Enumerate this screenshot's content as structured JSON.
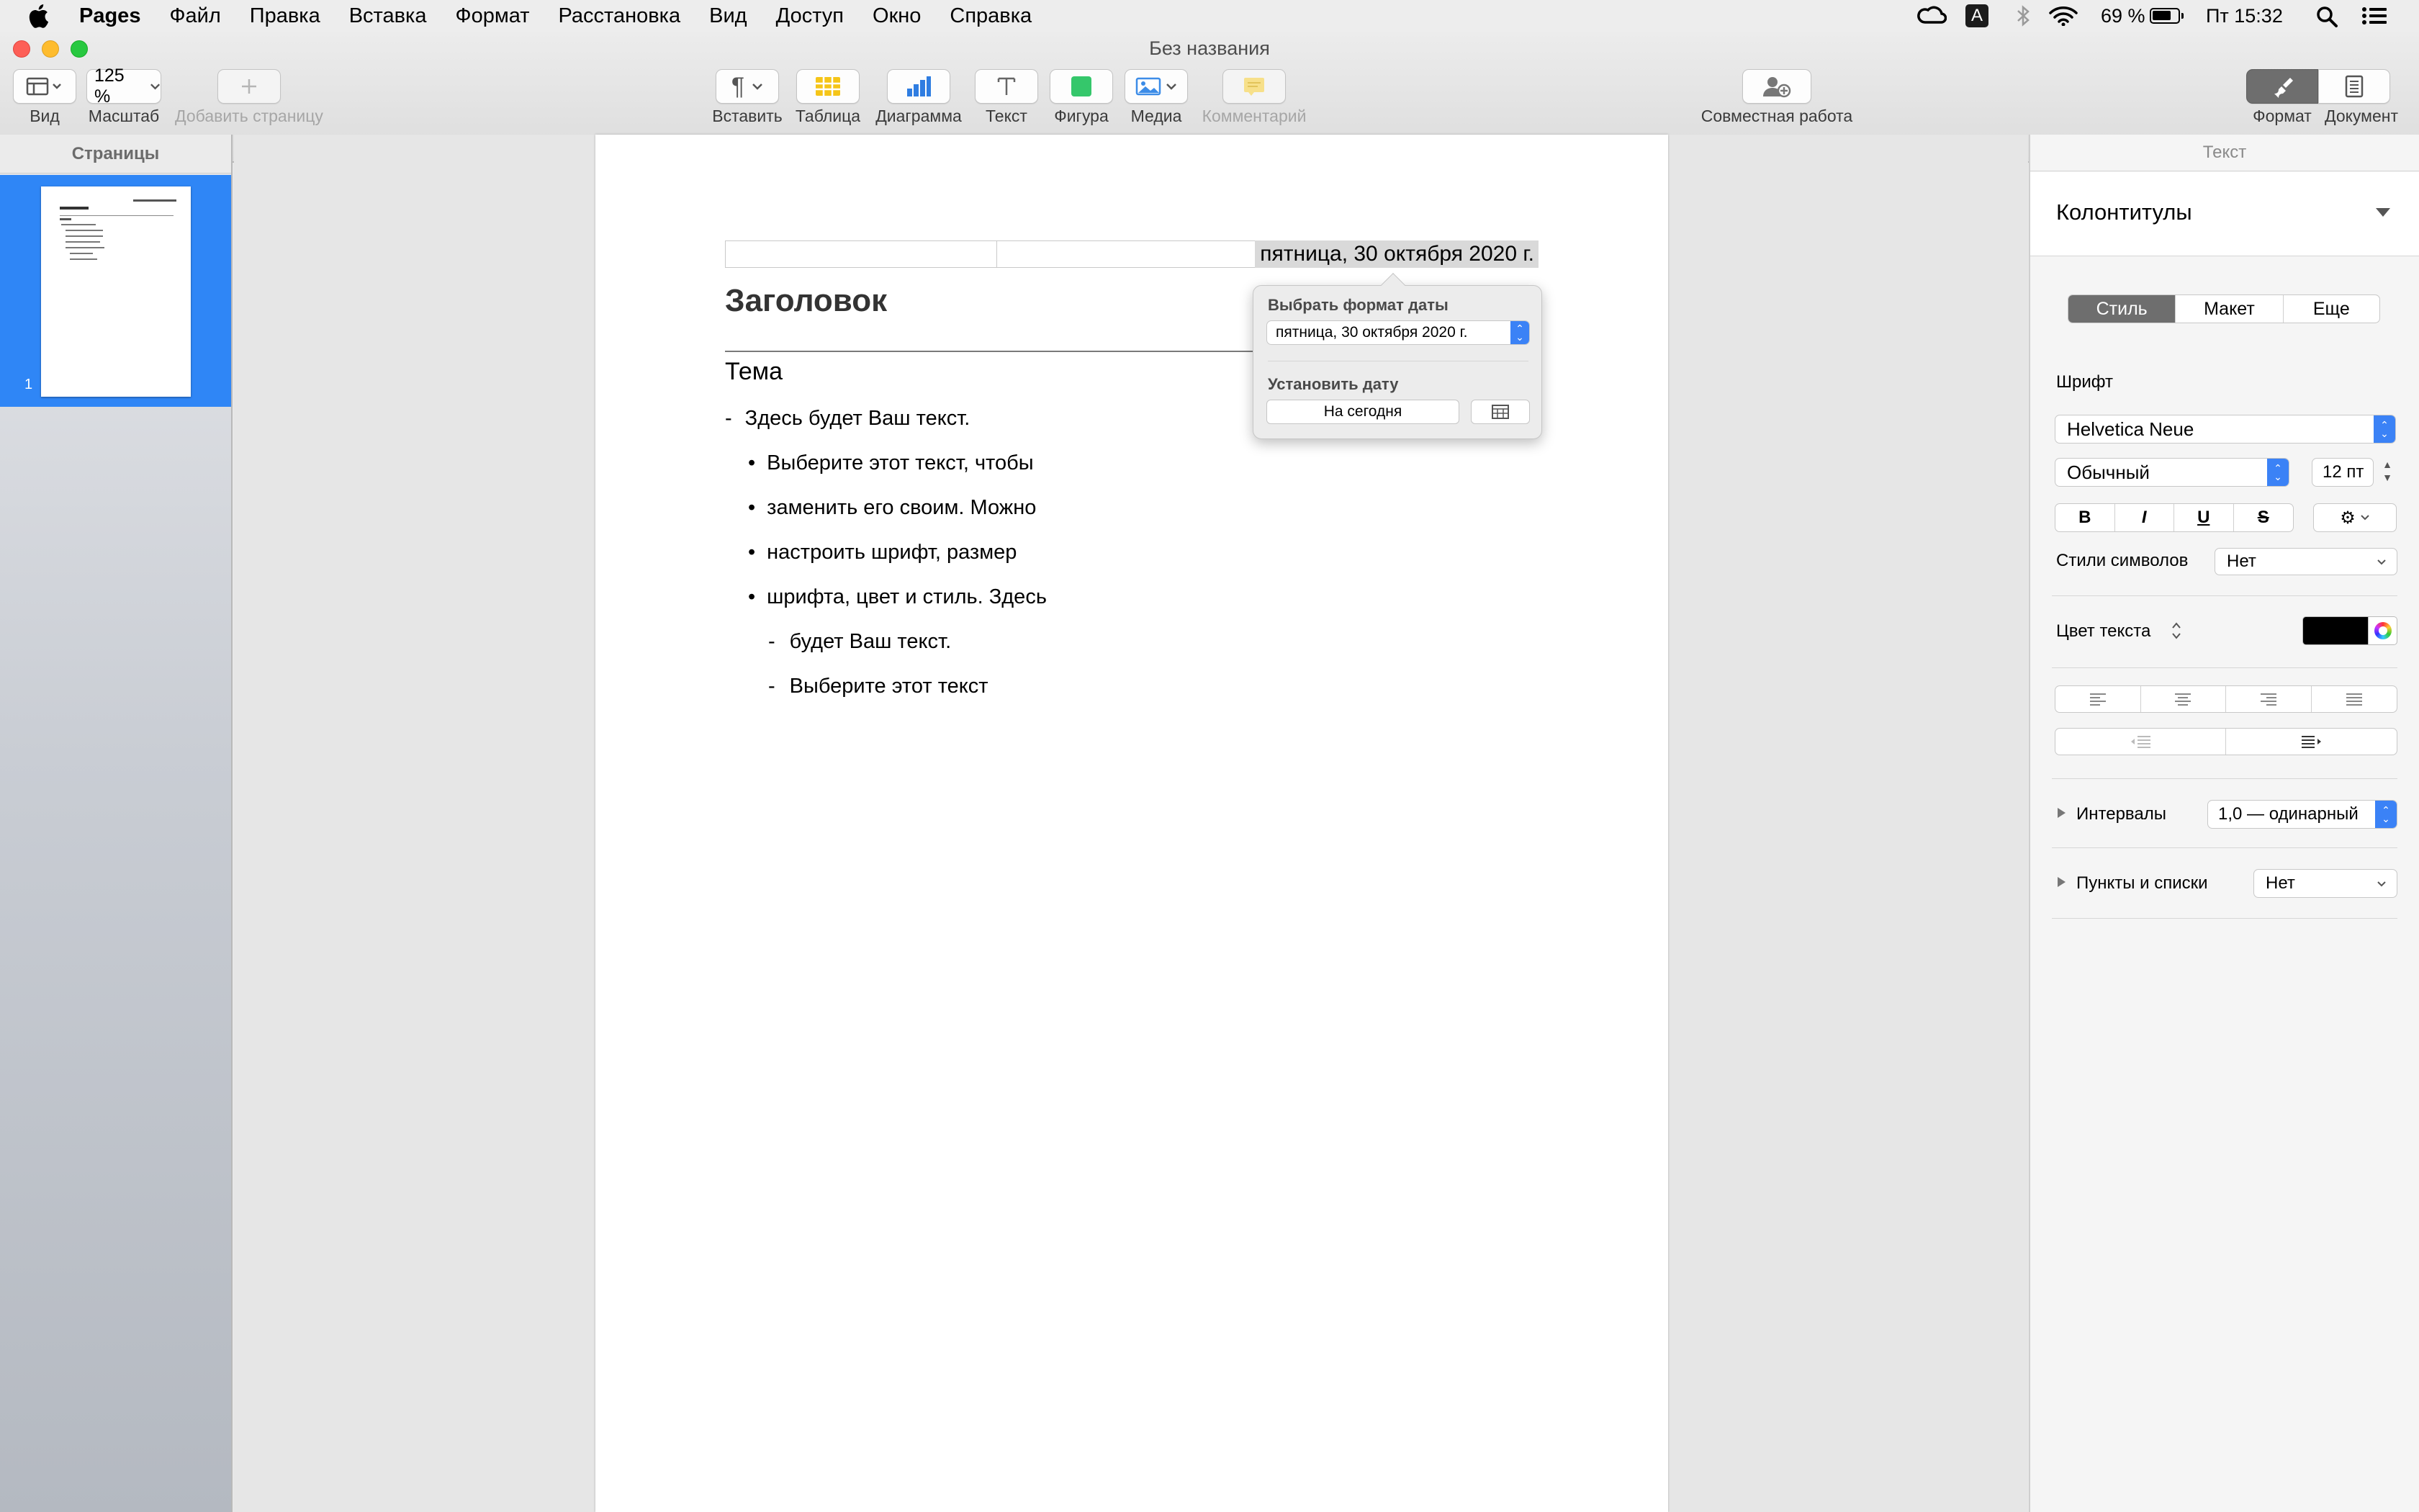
{
  "menubar": {
    "app_name": "Pages",
    "items": [
      "Файл",
      "Правка",
      "Вставка",
      "Формат",
      "Расстановка",
      "Вид",
      "Доступ",
      "Окно",
      "Справка"
    ],
    "battery": "69 %",
    "clock": "Пт 15:32",
    "keyboard_layout": "A"
  },
  "window": {
    "title": "Без названия"
  },
  "toolbar": {
    "view_label": "Вид",
    "zoom_value": "125 %",
    "zoom_label": "Масштаб",
    "add_page_label": "Добавить страницу",
    "insert_label": "Вставить",
    "table_label": "Таблица",
    "chart_label": "Диаграмма",
    "text_label": "Текст",
    "shape_label": "Фигура",
    "media_label": "Медиа",
    "comment_label": "Комментарий",
    "collab_label": "Совместная работа",
    "format_label": "Формат",
    "document_label": "Документ"
  },
  "sidebar": {
    "header": "Страницы",
    "page_number": "1"
  },
  "document": {
    "header_date": "пятница, 30 октября 2020 г.",
    "heading": "Заголовок",
    "subtitle": "Тема",
    "lines": [
      {
        "marker": "-",
        "text": "Здесь будет Ваш текст."
      },
      {
        "marker": "•",
        "text": "Выберите этот текст, чтобы"
      },
      {
        "marker": "•",
        "text": "заменить его своим. Можно"
      },
      {
        "marker": "•",
        "text": "настроить шрифт, размер"
      },
      {
        "marker": "•",
        "text": "шрифта, цвет и стиль. Здесь"
      },
      {
        "marker": "-",
        "text": "будет Ваш текст."
      },
      {
        "marker": "-",
        "text": "Выберите этот текст"
      }
    ]
  },
  "date_popover": {
    "format_title": "Выбрать формат даты",
    "format_value": "пятница, 30 октября 2020 г.",
    "set_date_title": "Установить дату",
    "today_button": "На сегодня"
  },
  "inspector": {
    "panel_title": "Текст",
    "paragraph_style": "Колонтитулы",
    "tabs": [
      "Стиль",
      "Макет",
      "Еще"
    ],
    "font_section": "Шрифт",
    "font_family": "Helvetica Neue",
    "font_typeface": "Обычный",
    "font_size": "12 пт",
    "bold": "B",
    "italic": "I",
    "underline": "U",
    "strike": "S",
    "char_styles_label": "Стили символов",
    "char_styles_value": "Нет",
    "text_color_label": "Цвет текста",
    "text_color": "#000000",
    "spacing_label": "Интервалы",
    "spacing_value": "1,0 — одинарный",
    "bullets_label": "Пункты и списки",
    "bullets_value": "Нет"
  },
  "colors": {
    "accent": "#3b82f6",
    "sidebar_selected": "#2f86f6"
  }
}
